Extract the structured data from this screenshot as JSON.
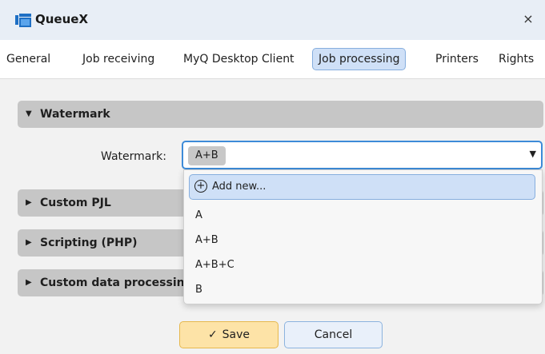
{
  "window": {
    "title": "QueueX",
    "close_glyph": "×"
  },
  "tabs": [
    {
      "label": "General"
    },
    {
      "label": "Job receiving"
    },
    {
      "label": "MyQ Desktop Client"
    },
    {
      "label": "Job processing",
      "active": true
    },
    {
      "label": "Printers"
    },
    {
      "label": "Rights"
    }
  ],
  "sections": {
    "watermark": {
      "label": "Watermark",
      "expanded": true
    },
    "custom_pjl": {
      "label": "Custom PJL"
    },
    "scripting": {
      "label": "Scripting (PHP)"
    },
    "custom_data": {
      "label": "Custom data processing"
    }
  },
  "watermark_field": {
    "label": "Watermark:",
    "selected": "A+B"
  },
  "dropdown": {
    "add_new": "Add new...",
    "options": [
      "A",
      "A+B",
      "A+B+C",
      "B"
    ]
  },
  "buttons": {
    "save": "Save",
    "cancel": "Cancel"
  },
  "colors": {
    "accent_blue": "#3d8bd8",
    "save_bg": "#fde3a7",
    "section_bg": "#c6c6c6"
  },
  "icons": {
    "app": "queue-window-icon",
    "close": "close-icon",
    "caret_down": "caret-down-icon",
    "caret_right": "caret-right-icon",
    "add": "plus-circle-icon",
    "save": "check-icon"
  }
}
